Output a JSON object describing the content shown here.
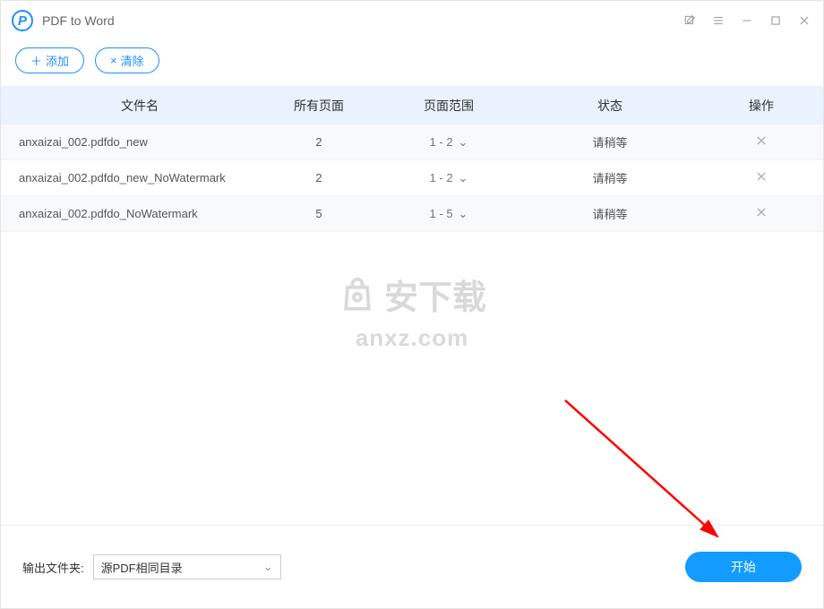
{
  "app": {
    "title": "PDF to Word"
  },
  "toolbar": {
    "add_label": "添加",
    "clear_label": "清除"
  },
  "table": {
    "headers": {
      "name": "文件名",
      "pages": "所有页面",
      "range": "页面范围",
      "status": "状态",
      "action": "操作"
    },
    "rows": [
      {
        "name": "anxaizai_002.pdfdo_new",
        "pages": "2",
        "range": "1 - 2",
        "status": "请稍等"
      },
      {
        "name": "anxaizai_002.pdfdo_new_NoWatermark",
        "pages": "2",
        "range": "1 - 2",
        "status": "请稍等"
      },
      {
        "name": "anxaizai_002.pdfdo_NoWatermark",
        "pages": "5",
        "range": "1 - 5",
        "status": "请稍等"
      }
    ]
  },
  "watermark": {
    "cn": "安下载",
    "domain": "anxz.com"
  },
  "footer": {
    "output_label": "输出文件夹:",
    "output_selected": "源PDF相同目录",
    "start_label": "开始"
  }
}
